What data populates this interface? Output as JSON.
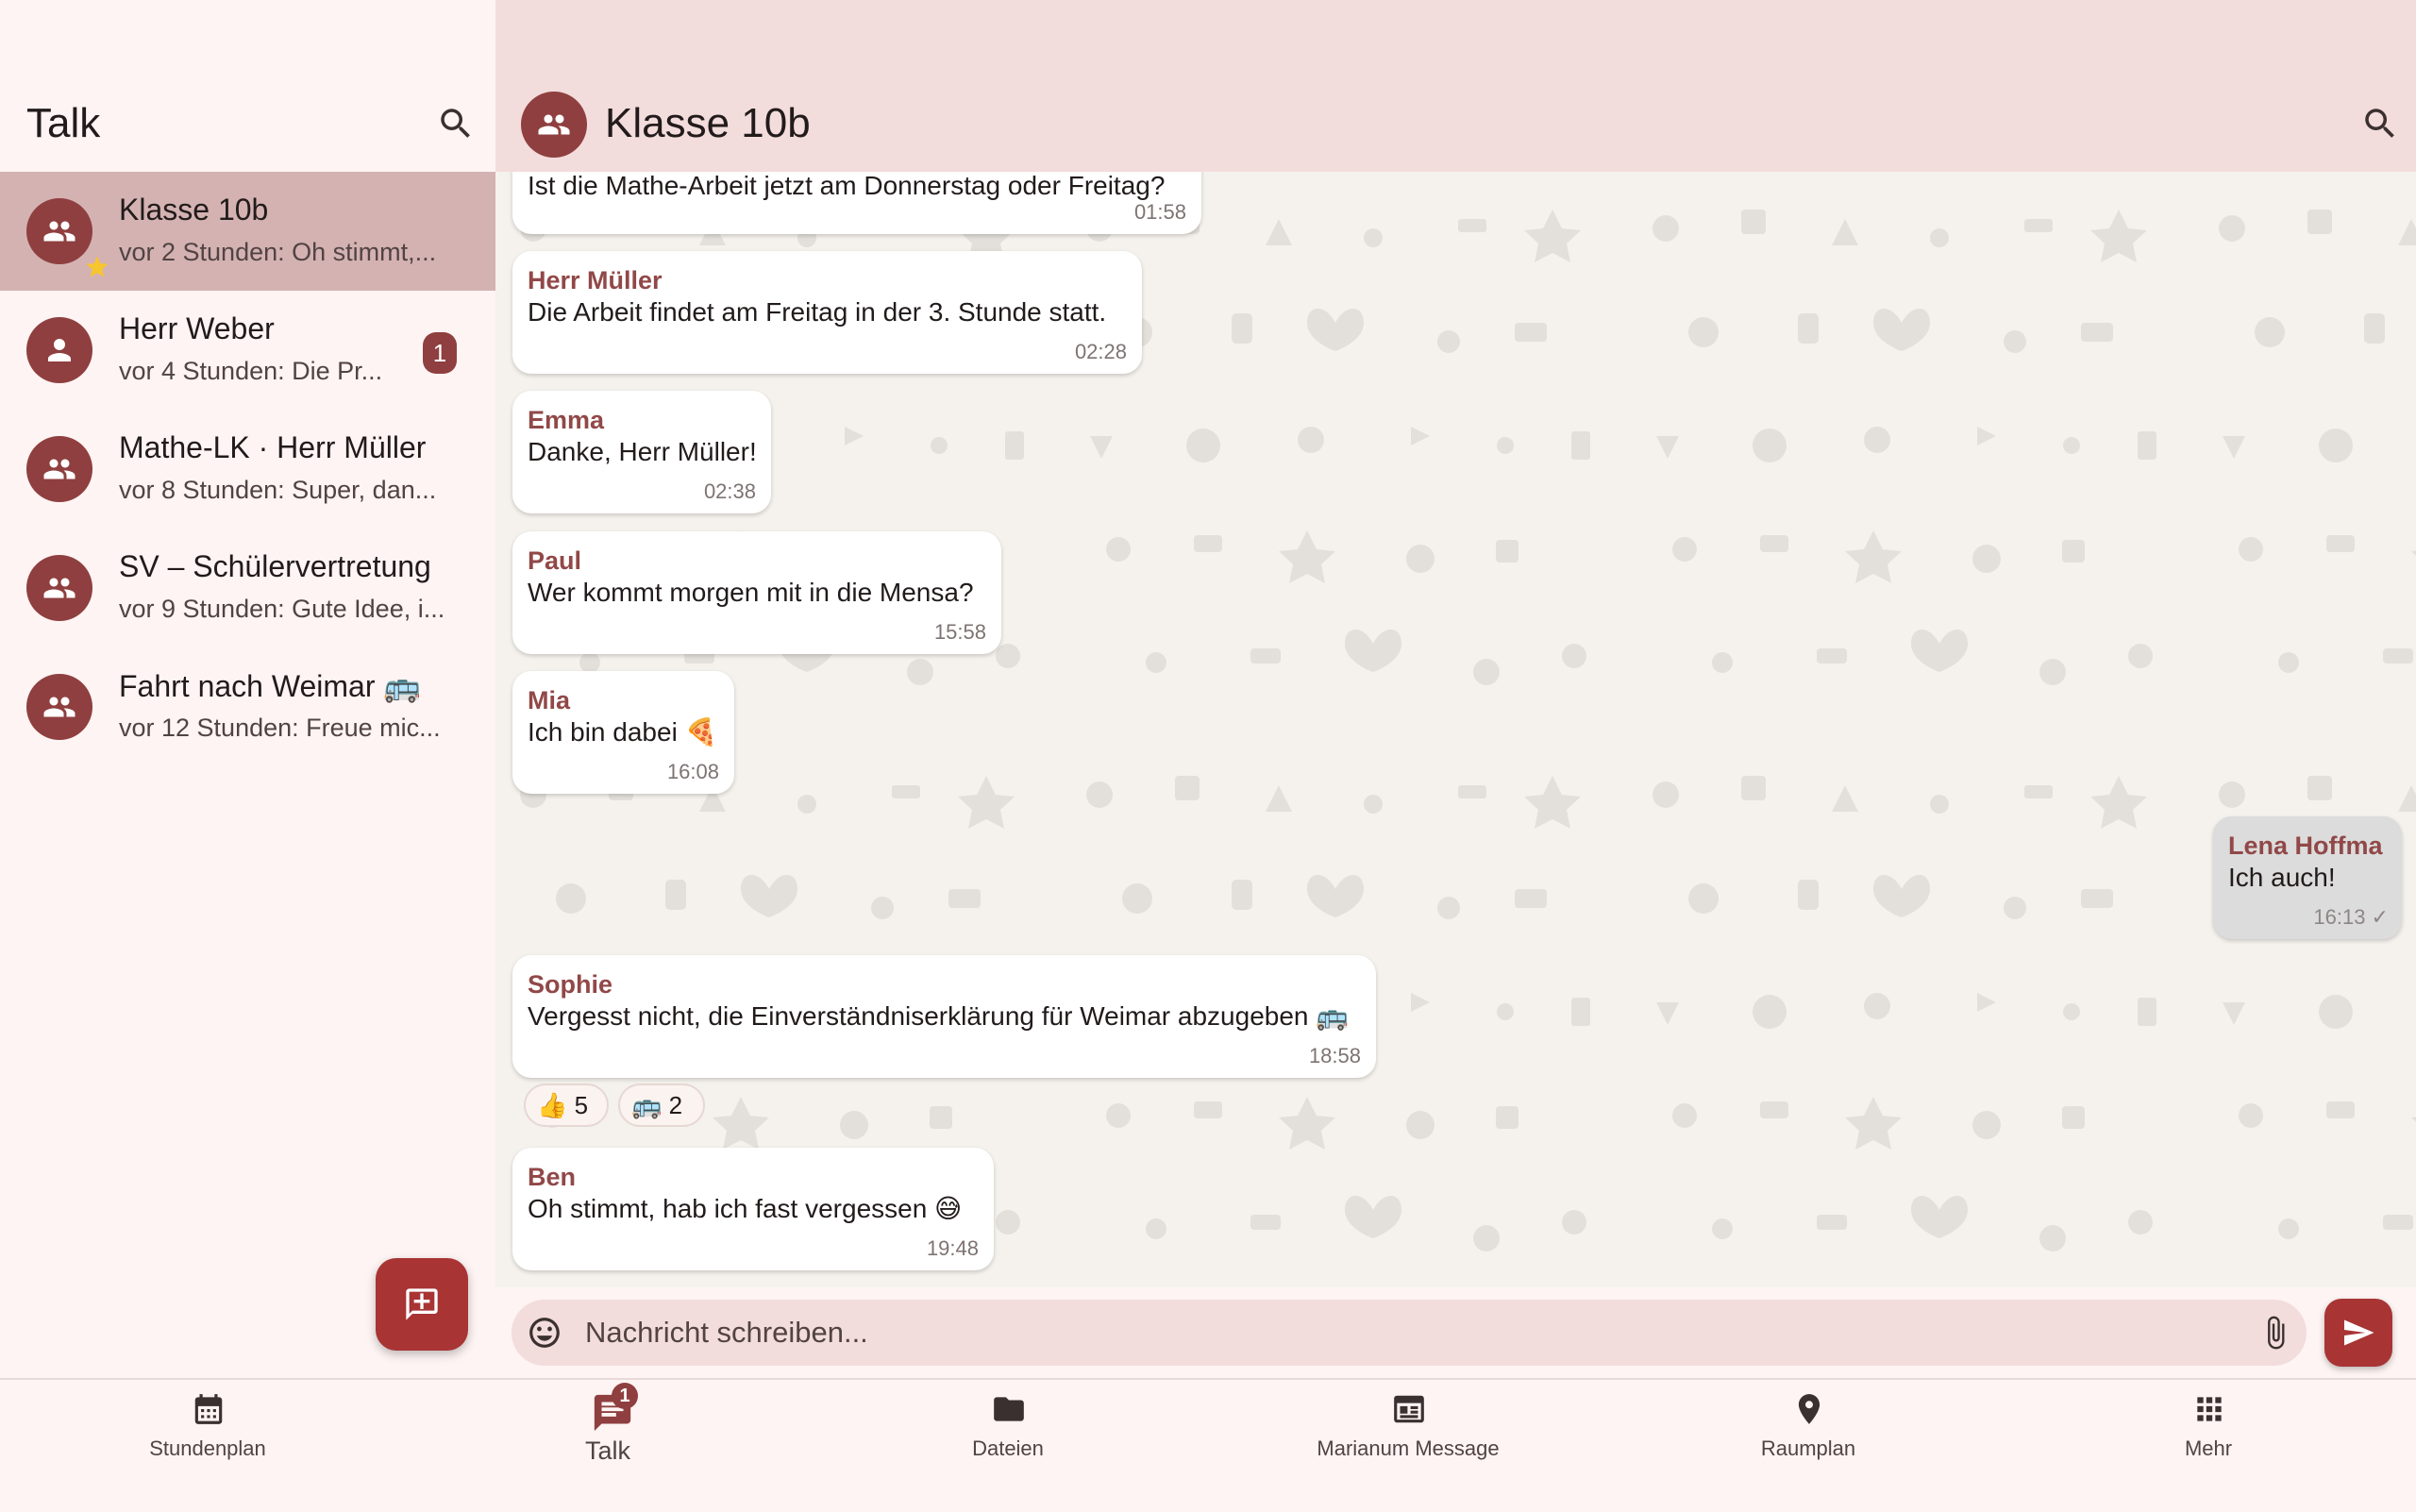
{
  "colors": {
    "primary": "#8f3f3f",
    "fab": "#a83434",
    "active_chat": "#d4b2b2",
    "header_bg": "#f3dcdc",
    "sender_name": "#914848",
    "chat_background": "#f5f2ed"
  },
  "sidebar": {
    "title": "Talk",
    "search_icon": "search-icon",
    "chats": [
      {
        "name": "Klasse 10b",
        "preview": "vor 2 Stunden: Oh stimmt,...",
        "icon": "group-icon",
        "active": true,
        "favorite": true
      },
      {
        "name": "Herr Weber",
        "preview": "vor 4 Stunden: Die Pr...",
        "icon": "person-icon",
        "unread": "1"
      },
      {
        "name": "Mathe-LK · Herr Müller",
        "preview": "vor 8 Stunden: Super, dan...",
        "icon": "group-icon"
      },
      {
        "name": "SV – Schülervertretung",
        "preview": "vor 9 Stunden: Gute Idee, i...",
        "icon": "group-icon"
      },
      {
        "name": "Fahrt nach Weimar 🚌",
        "preview": "vor 12 Stunden: Freue mic...",
        "icon": "group-icon"
      }
    ],
    "new_chat_icon": "add-chat-icon"
  },
  "header": {
    "title": "Klasse 10b",
    "search_icon": "search-icon"
  },
  "messages": [
    {
      "sender": "",
      "text": "Ist die Mathe-Arbeit jetzt am Donnerstag oder Freitag?",
      "time": "01:58"
    },
    {
      "sender": "Herr Müller",
      "text": "Die Arbeit findet am Freitag in der 3. Stunde statt.",
      "time": "02:28"
    },
    {
      "sender": "Emma",
      "text": "Danke, Herr Müller!",
      "time": "02:38"
    },
    {
      "sender": "Paul",
      "text": "Wer kommt morgen mit in die Mensa?",
      "time": "15:58"
    },
    {
      "sender": "Mia",
      "text": "Ich bin dabei 🍕",
      "time": "16:08"
    },
    {
      "sender": "Lena Hoffma",
      "text": "Ich auch!",
      "time": "16:13 ✓",
      "own": true
    },
    {
      "sender": "Sophie",
      "text": "Vergesst nicht, die Einverständniserklärung für Weimar abzugeben 🚌",
      "time": "18:58"
    },
    {
      "sender": "Ben",
      "text": "Oh stimmt, hab ich fast vergessen 😅",
      "time": "19:48"
    }
  ],
  "reactions": [
    {
      "emoji": "👍",
      "count": "5"
    },
    {
      "emoji": "🚌",
      "count": "2"
    }
  ],
  "composer": {
    "placeholder": "Nachricht schreiben...",
    "emoji_icon": "emoji-icon",
    "attach_icon": "attachment-icon",
    "send_icon": "send-icon"
  },
  "bottom_nav": {
    "items": [
      {
        "label": "Stundenplan",
        "icon": "calendar-icon"
      },
      {
        "label": "Talk",
        "icon": "chat-icon",
        "active": true,
        "badge": "1"
      },
      {
        "label": "Dateien",
        "icon": "folder-icon"
      },
      {
        "label": "Marianum Message",
        "icon": "newspaper-icon"
      },
      {
        "label": "Raumplan",
        "icon": "location-pin-icon"
      },
      {
        "label": "Mehr",
        "icon": "apps-grid-icon"
      }
    ]
  }
}
